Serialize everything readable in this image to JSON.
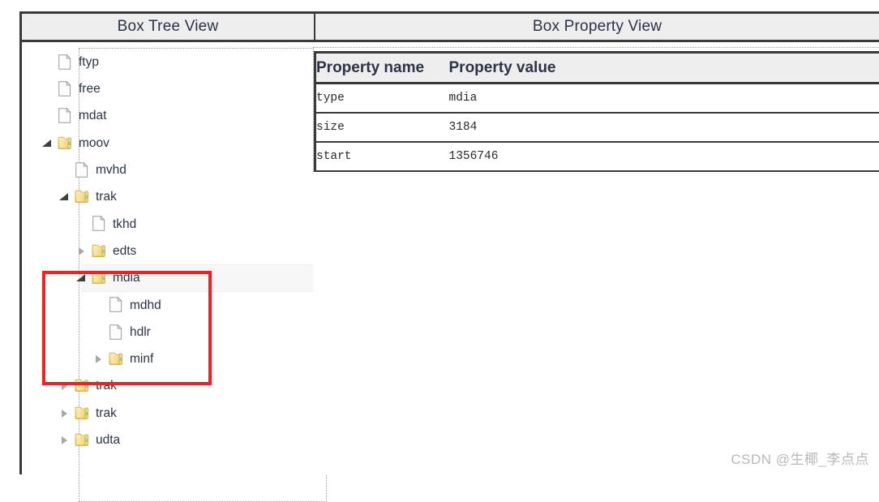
{
  "header": {
    "tree_panel_title": "Box Tree View",
    "property_panel_title": "Box Property View"
  },
  "tree": {
    "nodes": [
      {
        "label": "ftyp",
        "icon": "file-icon",
        "depth": 0,
        "twisty": "none",
        "selected": false
      },
      {
        "label": "free",
        "icon": "file-icon",
        "depth": 0,
        "twisty": "none",
        "selected": false
      },
      {
        "label": "mdat",
        "icon": "file-icon",
        "depth": 0,
        "twisty": "none",
        "selected": false
      },
      {
        "label": "moov",
        "icon": "folder-icon",
        "depth": 0,
        "twisty": "expanded",
        "selected": false
      },
      {
        "label": "mvhd",
        "icon": "file-icon",
        "depth": 1,
        "twisty": "none",
        "selected": false
      },
      {
        "label": "trak",
        "icon": "folder-icon",
        "depth": 1,
        "twisty": "expanded",
        "selected": false
      },
      {
        "label": "tkhd",
        "icon": "file-icon",
        "depth": 2,
        "twisty": "none",
        "selected": false
      },
      {
        "label": "edts",
        "icon": "folder-icon",
        "depth": 2,
        "twisty": "collapsed",
        "selected": false
      },
      {
        "label": "mdia",
        "icon": "folder-icon",
        "depth": 2,
        "twisty": "expanded",
        "selected": true
      },
      {
        "label": "mdhd",
        "icon": "file-icon",
        "depth": 3,
        "twisty": "none",
        "selected": false
      },
      {
        "label": "hdlr",
        "icon": "file-icon",
        "depth": 3,
        "twisty": "none",
        "selected": false
      },
      {
        "label": "minf",
        "icon": "folder-icon",
        "depth": 3,
        "twisty": "collapsed",
        "selected": false
      },
      {
        "label": "trak",
        "icon": "folder-icon",
        "depth": 1,
        "twisty": "collapsed",
        "selected": false
      },
      {
        "label": "trak",
        "icon": "folder-icon",
        "depth": 1,
        "twisty": "collapsed",
        "selected": false
      },
      {
        "label": "udta",
        "icon": "folder-icon",
        "depth": 1,
        "twisty": "collapsed",
        "selected": false
      }
    ]
  },
  "property_table": {
    "columns": [
      "Property name",
      "Property value"
    ],
    "rows": [
      [
        "type",
        "mdia"
      ],
      [
        "size",
        "3184"
      ],
      [
        "start",
        "1356746"
      ]
    ]
  },
  "annotation": {
    "highlight_color": "#f32020"
  },
  "watermark": {
    "text": "CSDN @生椰_李点点"
  }
}
